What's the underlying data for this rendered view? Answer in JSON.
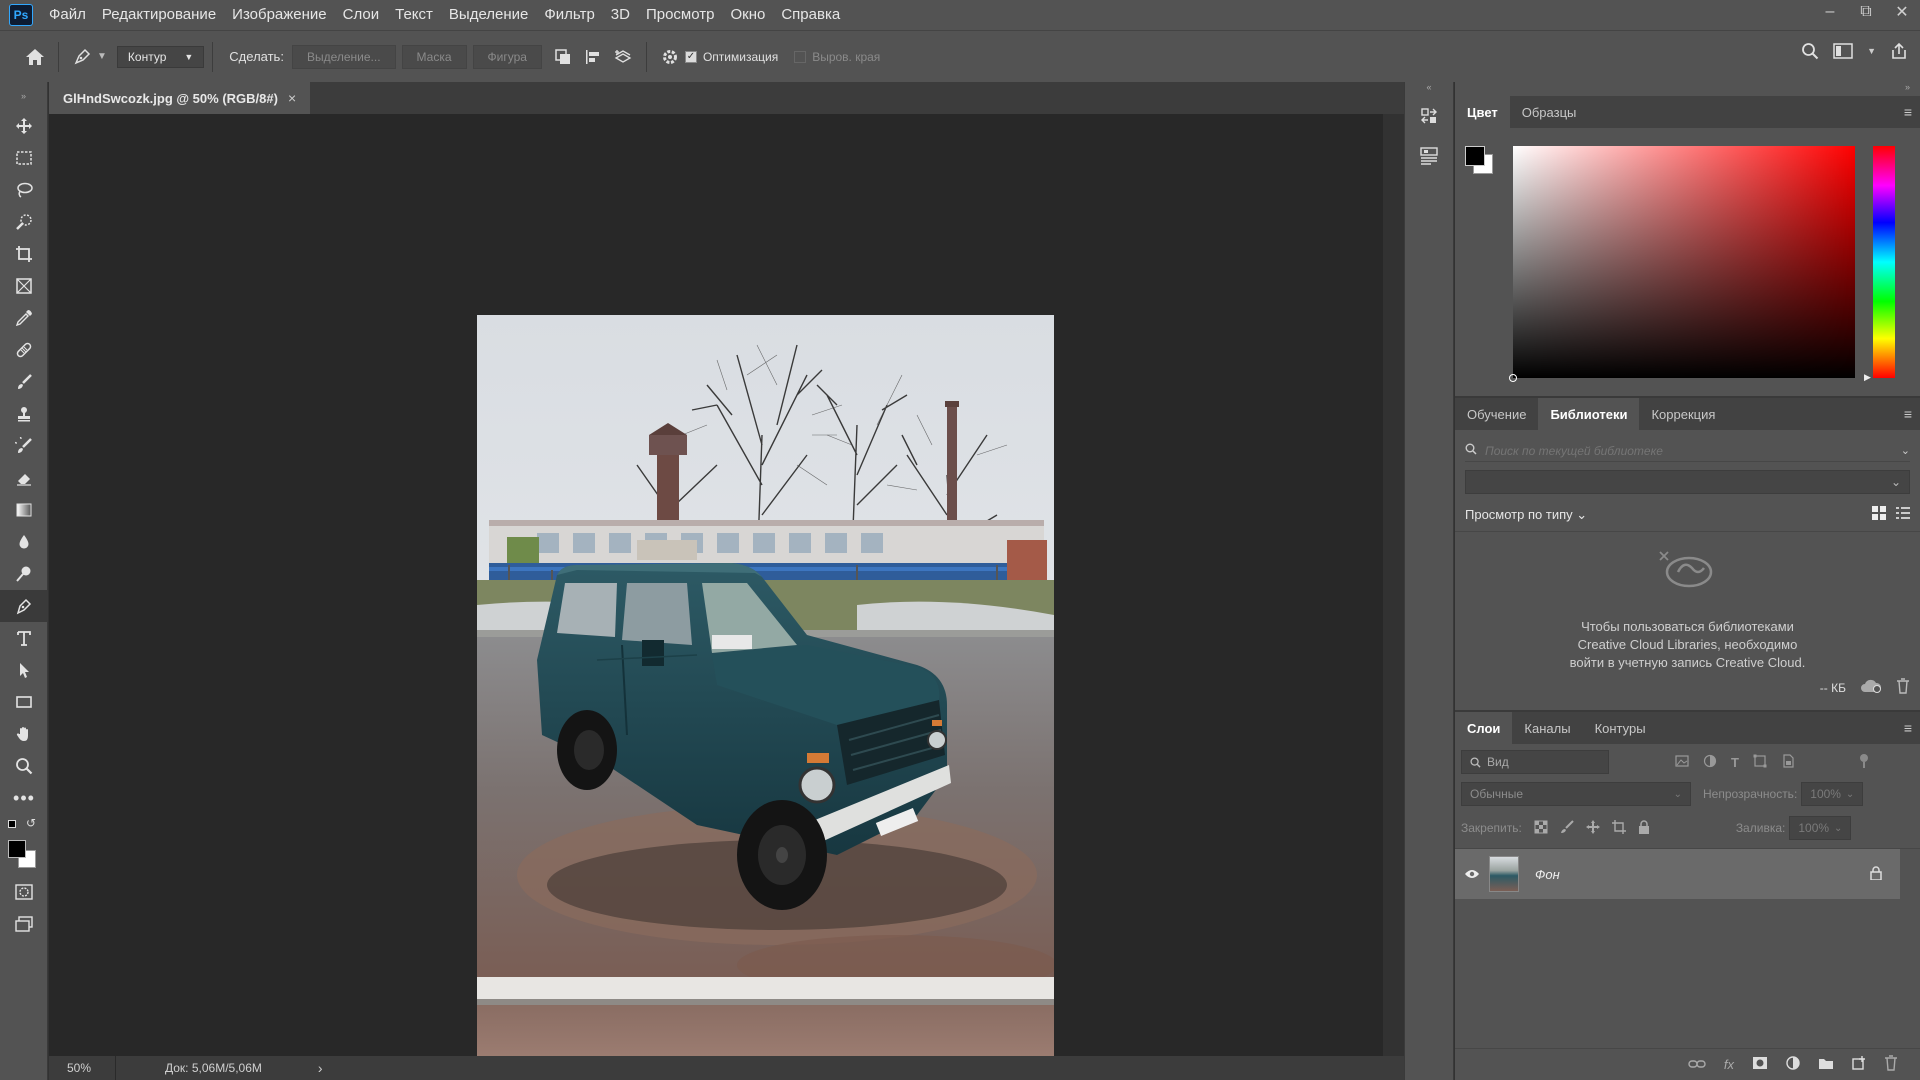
{
  "app": {
    "logo_text": "Ps"
  },
  "menu": [
    "Файл",
    "Редактирование",
    "Изображение",
    "Слои",
    "Текст",
    "Выделение",
    "Фильтр",
    "3D",
    "Просмотр",
    "Окно",
    "Справка"
  ],
  "options": {
    "mode_value": "Контур",
    "make_label": "Сделать:",
    "selection_btn": "Выделение...",
    "mask_btn": "Маска",
    "shape_btn": "Фигура",
    "optimize_label": "Оптимизация",
    "optimize_checked": true,
    "align_edges_label": "Выров. края",
    "align_edges_checked": false
  },
  "document": {
    "tab_title": "GlHndSwcozk.jpg @ 50% (RGB/8#)",
    "close_symbol": "×"
  },
  "status": {
    "zoom": "50%",
    "doc_info": "Док: 5,06M/5,06M",
    "arrow": "›"
  },
  "color_panel": {
    "tabs": [
      "Цвет",
      "Образцы"
    ],
    "foreground": "#000000",
    "background": "#ffffff",
    "hue": "#ff0000"
  },
  "libraries_panel": {
    "tabs": [
      "Обучение",
      "Библиотеки",
      "Коррекция"
    ],
    "search_placeholder": "Поиск по текущей библиотеке",
    "view_by_type": "Просмотр по типу",
    "message_line1": "Чтобы пользоваться библиотеками",
    "message_line2": "Creative Cloud Libraries, необходимо",
    "message_line3": "войти в учетную запись Creative Cloud.",
    "size_label": "-- КБ"
  },
  "layers_panel": {
    "tabs": [
      "Слои",
      "Каналы",
      "Контуры"
    ],
    "filter_placeholder": "Вид",
    "blend_mode": "Обычные",
    "opacity_label": "Непрозрачность:",
    "opacity_value": "100%",
    "lock_label": "Закрепить:",
    "fill_label": "Заливка:",
    "fill_value": "100%",
    "layers": [
      {
        "name": "Фон",
        "visible": true,
        "locked": true
      }
    ]
  }
}
